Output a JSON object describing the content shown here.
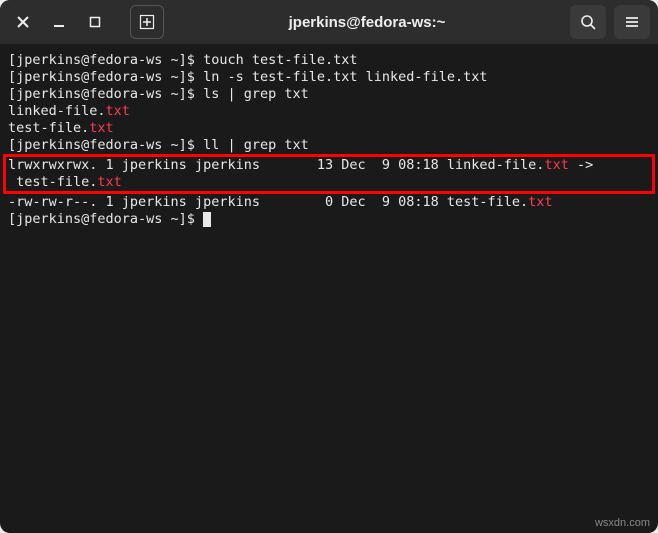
{
  "window": {
    "title": "jperkins@fedora-ws:~"
  },
  "terminal": {
    "lines": [
      {
        "segments": [
          {
            "t": "[jperkins@fedora-ws ~]$ touch test-file.txt"
          }
        ]
      },
      {
        "segments": [
          {
            "t": "[jperkins@fedora-ws ~]$ ln -s test-file.txt linked-file.txt"
          }
        ]
      },
      {
        "segments": [
          {
            "t": "[jperkins@fedora-ws ~]$ ls | grep txt"
          }
        ]
      },
      {
        "segments": [
          {
            "t": "linked-file."
          },
          {
            "t": "txt",
            "c": "hl-txt"
          }
        ]
      },
      {
        "segments": [
          {
            "t": "test-file."
          },
          {
            "t": "txt",
            "c": "hl-txt"
          }
        ]
      },
      {
        "segments": [
          {
            "t": "[jperkins@fedora-ws ~]$ ll | grep txt"
          }
        ]
      }
    ],
    "boxed_lines": [
      {
        "segments": [
          {
            "t": "lrwxrwxrwx. 1 jperkins jperkins       13 Dec  9 08:18 linked-file."
          },
          {
            "t": "txt",
            "c": "hl-txt"
          },
          {
            "t": " ->"
          }
        ]
      },
      {
        "segments": [
          {
            "t": " test-file."
          },
          {
            "t": "txt",
            "c": "hl-txt"
          }
        ]
      }
    ],
    "lines_after": [
      {
        "segments": [
          {
            "t": "-rw-rw-r--. 1 jperkins jperkins        0 Dec  9 08:18 test-file."
          },
          {
            "t": "txt",
            "c": "hl-txt"
          }
        ]
      }
    ],
    "prompt_final": "[jperkins@fedora-ws ~]$ "
  },
  "watermark": "wsxdn.com"
}
